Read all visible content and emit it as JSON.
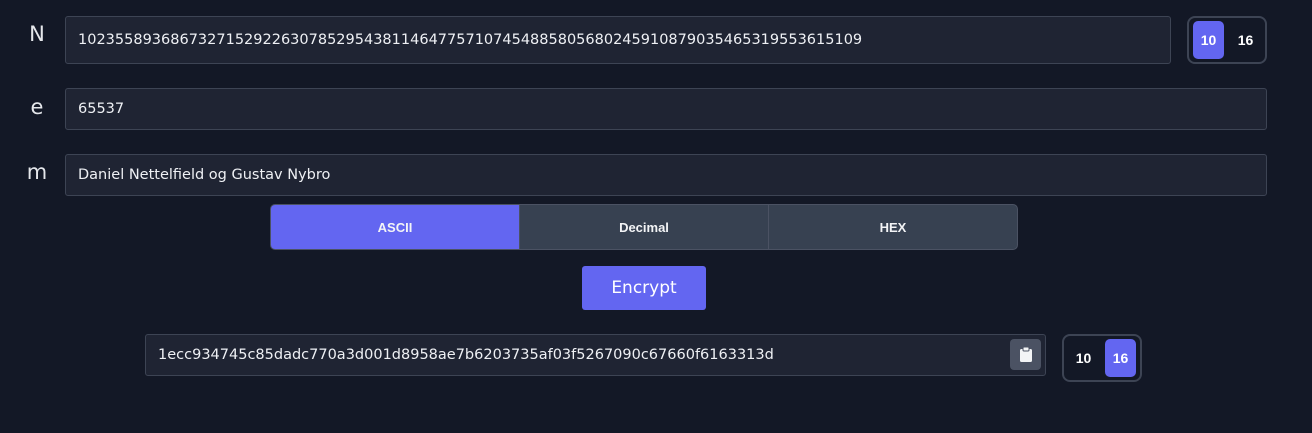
{
  "inputs": {
    "n": {
      "label": "N",
      "value": "1023558936867327152922630785295438114647757107454885805680245910879035465319553615109"
    },
    "e": {
      "label": "e",
      "value": "65537"
    },
    "m": {
      "label": "m",
      "value": "Daniel Nettelfield og Gustav Nybro"
    }
  },
  "n_base_toggle": {
    "options": [
      "10",
      "16"
    ],
    "selected": "10"
  },
  "encoding": {
    "options": [
      "ASCII",
      "Decimal",
      "HEX"
    ],
    "selected": "ASCII"
  },
  "encrypt_button": {
    "label": "Encrypt"
  },
  "output": {
    "value": "1ecc934745c85dadc770a3d001d8958ae7b6203735af03f5267090c67660f6163313d",
    "copy_icon": "clipboard-icon"
  },
  "output_base_toggle": {
    "options": [
      "10",
      "16"
    ],
    "selected": "16"
  },
  "colors": {
    "background": "#131826",
    "accent": "#6366f1",
    "field": "#1f2433",
    "segment": "#374151"
  }
}
